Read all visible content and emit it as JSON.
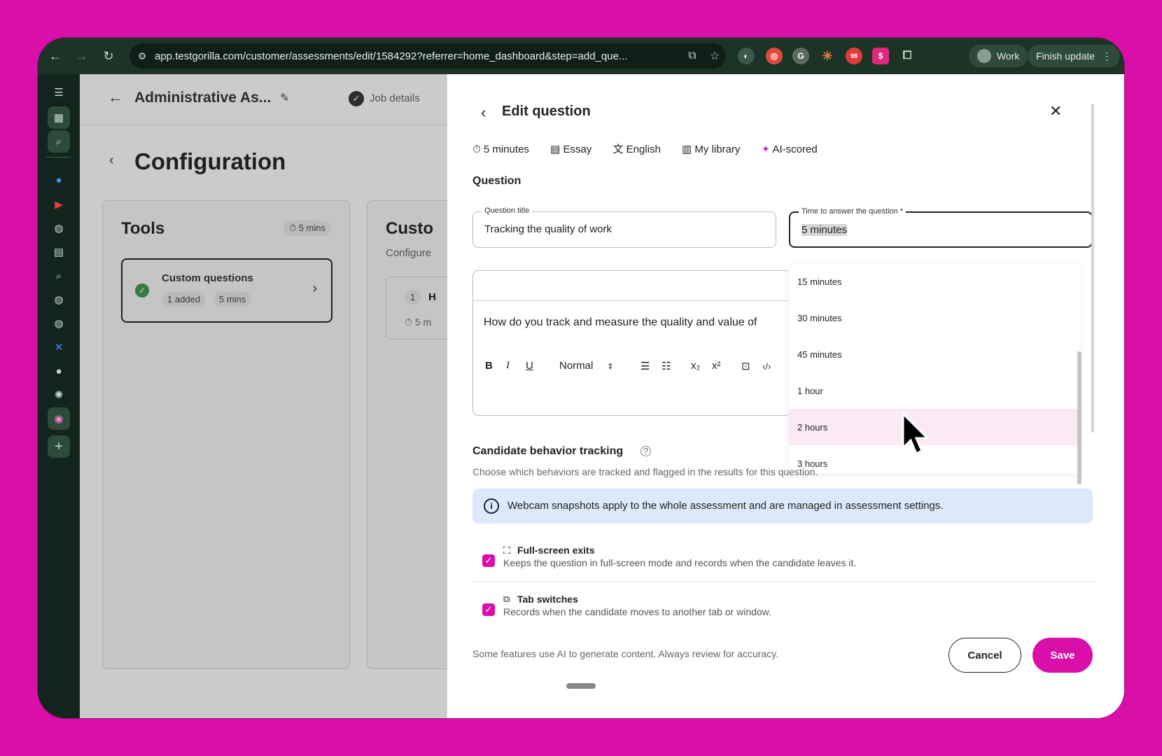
{
  "browser": {
    "url": "app.testgorilla.com/customer/assessments/edit/1584292?referrer=home_dashboard&step=add_que...",
    "profile_label": "Work",
    "update_label": "Finish update",
    "ext_badge": "98"
  },
  "background_page": {
    "assessment_title": "Administrative As...",
    "step_label": "Job details",
    "section_title": "Configuration",
    "tools_card": {
      "title": "Tools",
      "time_chip": "5 mins",
      "item_title": "Custom questions",
      "item_chip_added": "1 added",
      "item_chip_time": "5 mins"
    },
    "custom_card": {
      "title": "Custo",
      "subtitle": "Configure",
      "row_num": "1",
      "row_text": "H",
      "row_time": "5 m"
    }
  },
  "panel": {
    "title": "Edit question",
    "meta": {
      "duration": "5 minutes",
      "type": "Essay",
      "language": "English",
      "source": "My library",
      "scoring": "AI-scored"
    },
    "question_heading": "Question",
    "question_title_label": "Question title",
    "question_title_value": "Tracking the quality of work",
    "time_label": "Time to answer the question *",
    "time_value": "5 minutes",
    "editor": {
      "format_label": "Normal",
      "body": "How do you track and measure the quality and value of"
    },
    "dropdown_options": [
      "15 minutes",
      "30 minutes",
      "45 minutes",
      "1 hour",
      "2 hours",
      "3 hours"
    ],
    "tracking_heading": "Candidate behavior tracking",
    "tracking_desc": "Choose which behaviors are tracked and flagged in the results for this question.",
    "info_banner": "Webcam snapshots apply to the whole assessment and are managed in assessment settings.",
    "checkboxes": [
      {
        "title": "Full-screen exits",
        "desc": "Keeps the question in full-screen mode and records when the candidate leaves it."
      },
      {
        "title": "Tab switches",
        "desc": "Records when the candidate moves to another tab or window."
      }
    ],
    "footer_note": "Some features use AI to generate content. Always review for accuracy.",
    "cancel_label": "Cancel",
    "save_label": "Save"
  },
  "colors": {
    "accent": "#d90fa9",
    "sidebar": "#12251c",
    "banner": "#dbe9fb"
  }
}
